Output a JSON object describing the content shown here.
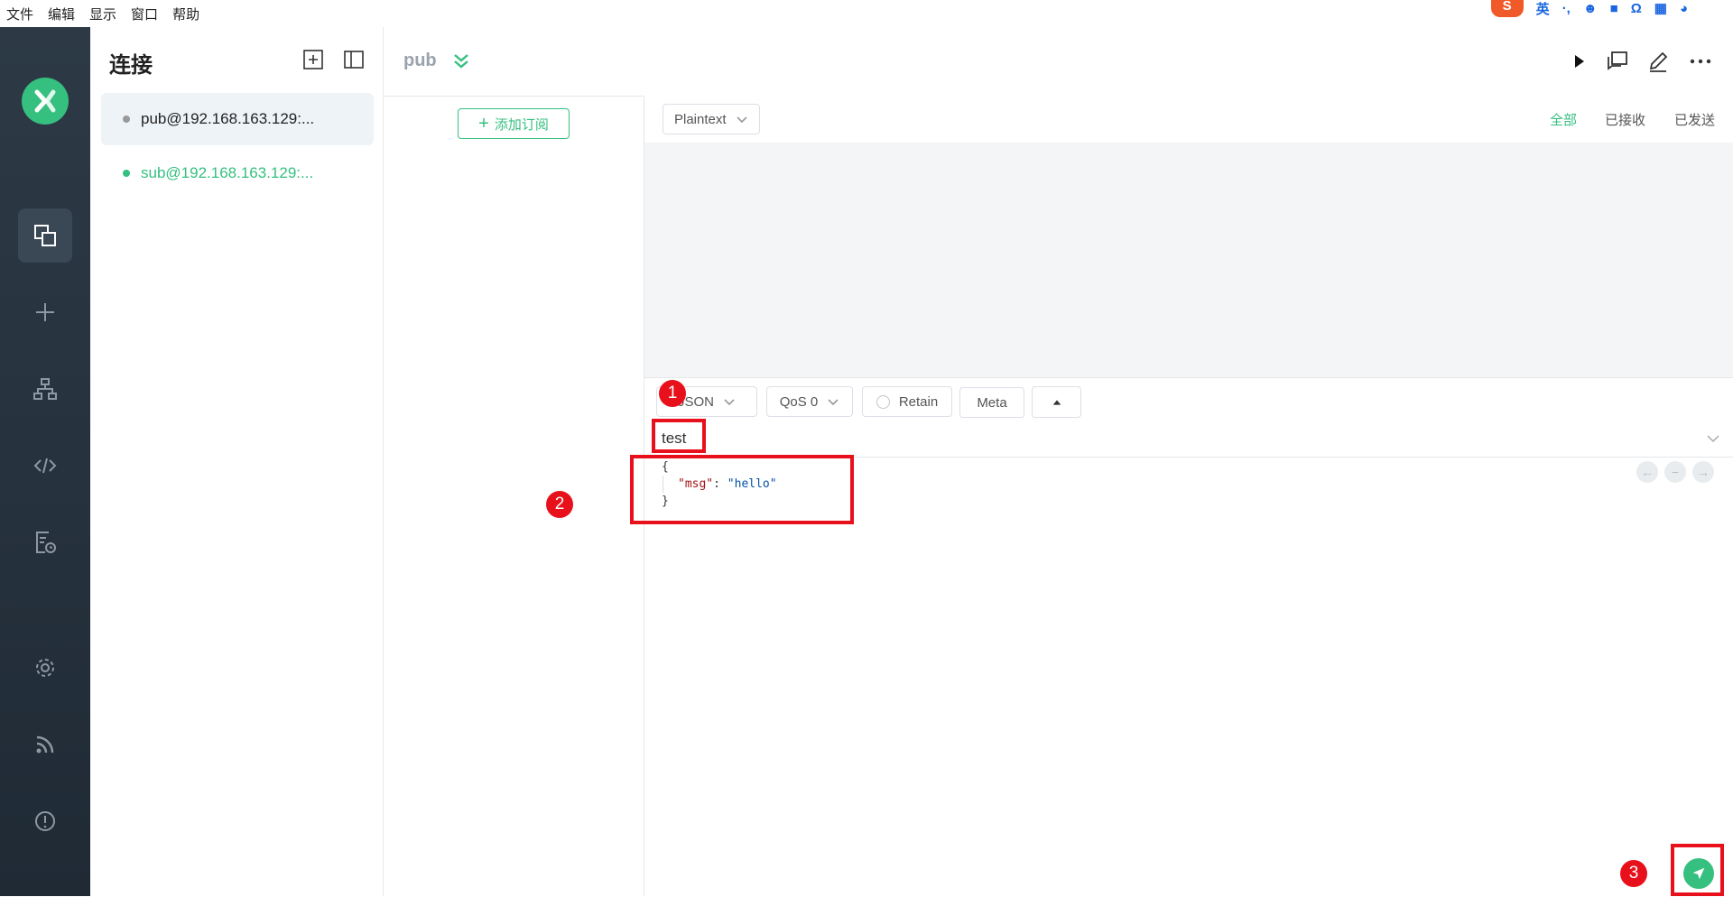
{
  "menu": [
    "文件",
    "编辑",
    "显示",
    "窗口",
    "帮助"
  ],
  "tray": {
    "logo": "S",
    "ime": "英"
  },
  "sidebar": {
    "title": "连接",
    "connections": [
      {
        "label": "pub@192.168.163.129:...",
        "status": "disconnected",
        "color": "#999999"
      },
      {
        "label": "sub@192.168.163.129:...",
        "status": "connected",
        "color": "#35c07f"
      }
    ]
  },
  "header": {
    "connection_name": "pub"
  },
  "subscriptions": {
    "add_label": "添加订阅"
  },
  "messages": {
    "format": "Plaintext",
    "filters": [
      "全部",
      "已接收",
      "已发送"
    ],
    "active_filter": "全部"
  },
  "composer": {
    "payload_format": "JSON",
    "qos": "QoS 0",
    "retain_label": "Retain",
    "meta_label": "Meta",
    "topic": "test",
    "payload_lines": {
      "open": "{",
      "key": "\"msg\"",
      "colon": ": ",
      "value": "\"hello\"",
      "close": "}"
    }
  },
  "annotations": [
    "1",
    "2",
    "3"
  ],
  "colors": {
    "accent": "#35c07f",
    "rail": "#2d3a46",
    "annotation": "#e8101a"
  }
}
